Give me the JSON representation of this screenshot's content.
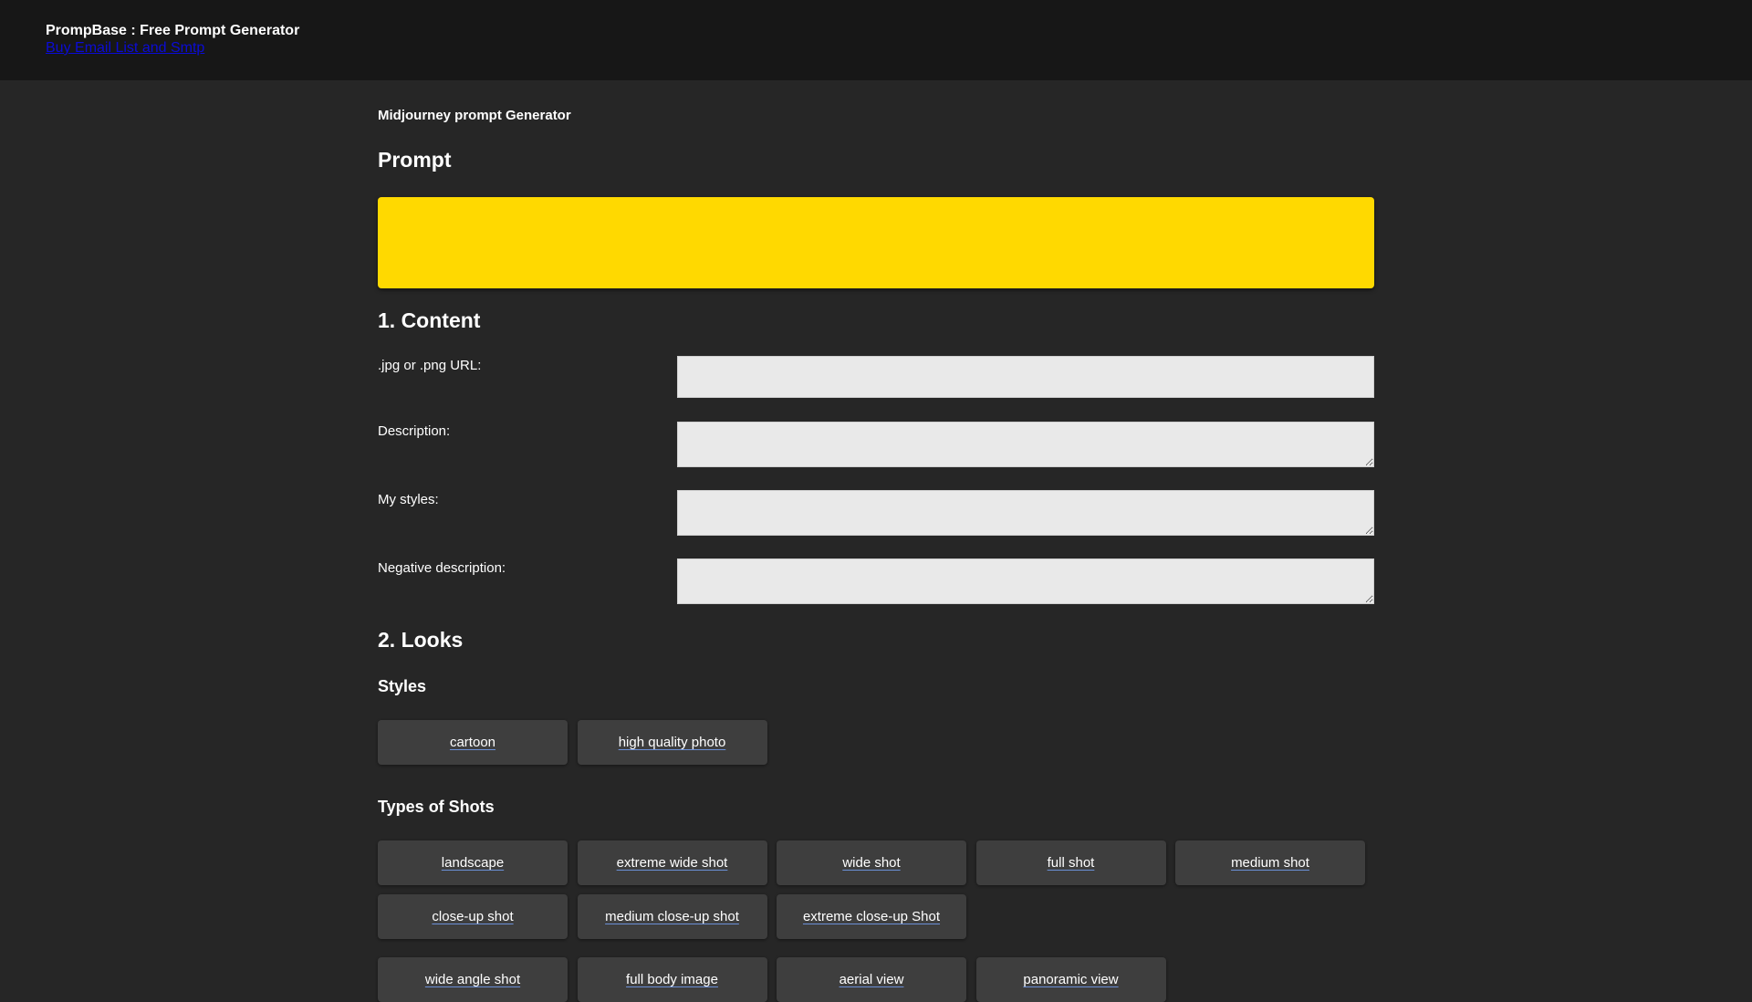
{
  "header": {
    "title": "PrompBase : Free Prompt Generator",
    "link_label": "Buy Email List and Smtp"
  },
  "main": {
    "generator_title": "Midjourney prompt Generator",
    "prompt_heading": "Prompt",
    "prompt_value": "",
    "prompt_color": "#ffd900",
    "content": {
      "heading": "1. Content",
      "fields": [
        {
          "label": ".jpg or .png URL:",
          "value": ""
        },
        {
          "label": "Description:",
          "value": ""
        },
        {
          "label": "My styles:",
          "value": ""
        },
        {
          "label": "Negative description:",
          "value": ""
        }
      ]
    },
    "looks": {
      "heading": "2. Looks",
      "styles": {
        "heading": "Styles",
        "options": [
          "cartoon",
          "high quality photo"
        ]
      },
      "shots": {
        "heading": "Types of Shots",
        "options": [
          "landscape",
          "extreme wide shot",
          "wide shot",
          "full shot",
          "medium shot",
          "close-up shot",
          "medium close-up shot",
          "extreme close-up Shot",
          "wide angle shot",
          "full body image",
          "aerial view",
          "panoramic view"
        ]
      }
    }
  }
}
